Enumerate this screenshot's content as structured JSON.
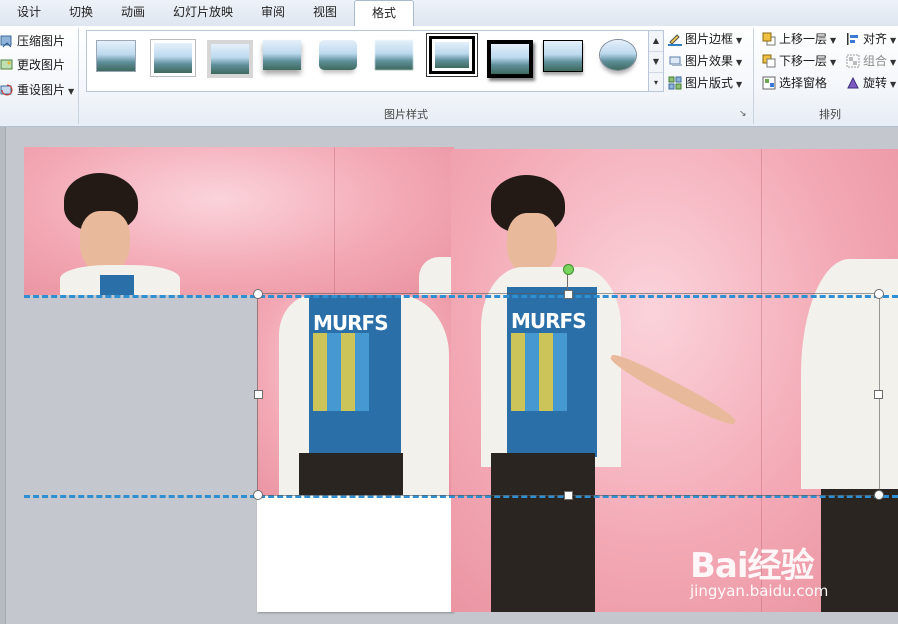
{
  "tabs": [
    {
      "label": "设计",
      "active": false
    },
    {
      "label": "切换",
      "active": false
    },
    {
      "label": "动画",
      "active": false
    },
    {
      "label": "幻灯片放映",
      "active": false
    },
    {
      "label": "审阅",
      "active": false
    },
    {
      "label": "视图",
      "active": false
    },
    {
      "label": "格式",
      "active": true
    }
  ],
  "adjust": {
    "compress": "压缩图片",
    "change": "更改图片",
    "reset": "重设图片"
  },
  "picture_styles": {
    "group_label": "图片样式",
    "border": "图片边框",
    "effects": "图片效果",
    "layout": "图片版式"
  },
  "arrange": {
    "group_label": "排列",
    "bring_forward": "上移一层",
    "send_backward": "下移一层",
    "selection_pane": "选择窗格",
    "align": "对齐",
    "group": "组合",
    "rotate": "旋转"
  },
  "slide": {
    "shirt_print": "MURFS"
  },
  "watermark": {
    "brand": "Bai经验",
    "url": "jingyan.baidu.com"
  },
  "colors": {
    "guide": "#2f8fd0",
    "rotate_handle": "#7ad35c",
    "active_tab_border": "#a9b9d0"
  }
}
